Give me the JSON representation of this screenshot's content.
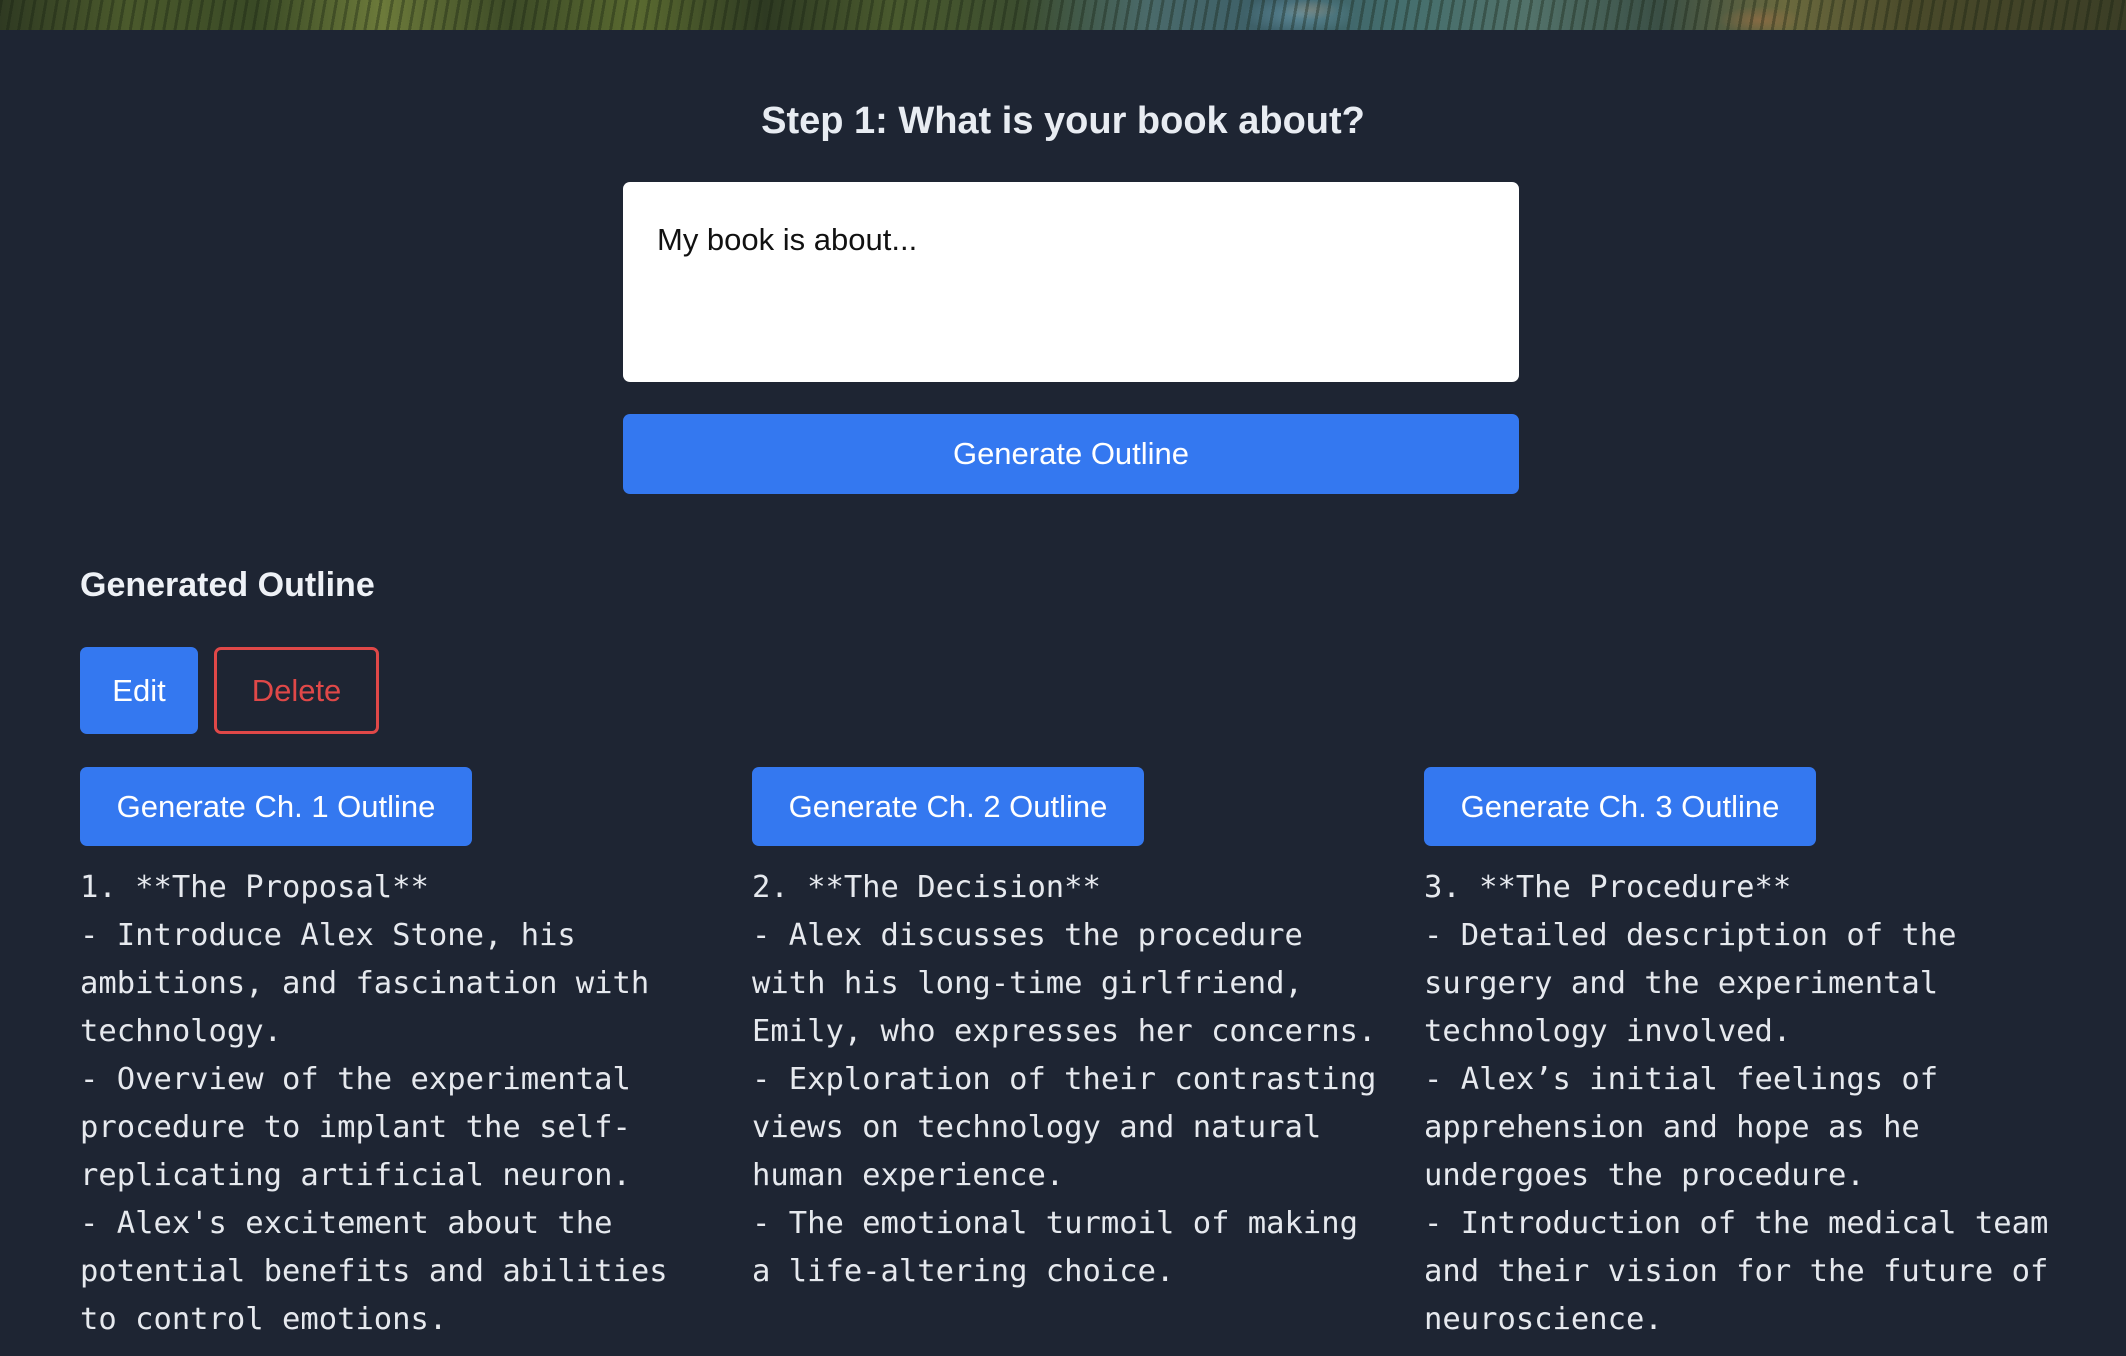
{
  "step": {
    "title": "Step 1: What is your book about?",
    "input_placeholder": "My book is about...",
    "generate_button_label": "Generate Outline"
  },
  "outline": {
    "heading": "Generated Outline",
    "edit_label": "Edit",
    "delete_label": "Delete",
    "chapters": [
      {
        "button_label": "Generate Ch. 1 Outline",
        "text": "1. **The Proposal**\n- Introduce Alex Stone, his ambitions, and fascination with technology.\n- Overview of the experimental procedure to implant the self-replicating artificial neuron.\n- Alex's excitement about the potential benefits and abilities to control emotions."
      },
      {
        "button_label": "Generate Ch. 2 Outline",
        "text": "2. **The Decision**\n- Alex discusses the procedure with his long-time girlfriend, Emily, who expresses her concerns.\n- Exploration of their contrasting views on technology and natural human experience.\n- The emotional turmoil of making a life-altering choice."
      },
      {
        "button_label": "Generate Ch. 3 Outline",
        "text": "3. **The Procedure**\n- Detailed description of the surgery and the experimental technology involved.\n- Alex’s initial feelings of apprehension and hope as he undergoes the procedure.\n- Introduction of the medical team and their vision for the future of neuroscience."
      }
    ]
  },
  "colors": {
    "background": "#1e2533",
    "primary_button": "#3478f0",
    "danger": "#e04848",
    "text": "#ffffff"
  }
}
